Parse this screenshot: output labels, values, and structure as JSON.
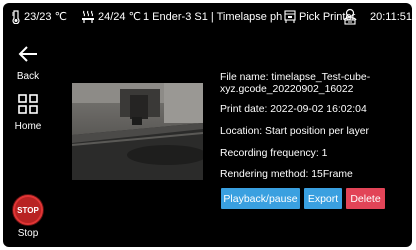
{
  "status_bar": {
    "nozzle_temp": "23/23 ℃",
    "bed_temp": "24/24 ℃",
    "printer_name": "1 Ender-3 S1 | Timelapse ph",
    "pick_printer": "Pick Printer",
    "time": "20:11:51"
  },
  "sidebar": {
    "back_label": "Back",
    "home_label": "Home",
    "stop_icon_text": "STOP",
    "stop_label": "Stop"
  },
  "details": {
    "file_name": "File name: timelapse_Test-cube-xyz.gcode_20220902_16022",
    "print_date": "Print date: 2022-09-02 16:02:04",
    "location": "Location: Start position per layer",
    "recording_frequency": "Recording frequency: 1",
    "rendering_method": "Rendering method: 15Frame"
  },
  "actions": {
    "playback": "Playback/pause",
    "export": "Export",
    "delete": "Delete"
  },
  "colors": {
    "background": "#000000",
    "primary_button": "#3aa0e0",
    "danger_button": "#e24457",
    "stop_red": "#b82222"
  },
  "icons": [
    "thermometer-icon",
    "bed-heat-icon",
    "printer-select-icon",
    "network-icon",
    "back-arrow-icon",
    "home-grid-icon",
    "stop-icon"
  ]
}
